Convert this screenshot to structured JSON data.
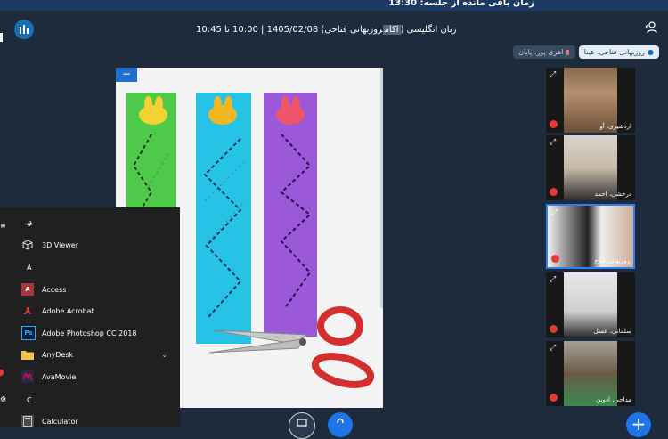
{
  "topbar": {
    "timer_text": "زمان باقی مانده از جلسه: 13:30"
  },
  "header": {
    "title_before": "زبان انگلیسی (",
    "title_highlight": "اکام",
    "title_after": "روزبهانی فتاحی) 1405/02/08 | 10:00 تا 10:45"
  },
  "chips": [
    {
      "label": "روزبهانی فتاحی، هینا",
      "icon": "pin-icon"
    },
    {
      "label": "اهری پور، پایان",
      "icon": "pin-icon"
    }
  ],
  "content": {
    "minimize_label": "−"
  },
  "participants": [
    {
      "name": "اردشیری، آوا"
    },
    {
      "name": "درخشی، احمد"
    },
    {
      "name": "روزبهانی فتاح"
    },
    {
      "name": "سلمانی، عسل"
    },
    {
      "name": "مداحی، ادوین"
    }
  ],
  "start_menu": {
    "sections": [
      {
        "letter": "#",
        "items": [
          {
            "label": "3D Viewer",
            "icon": "cube-icon"
          }
        ]
      },
      {
        "letter": "A",
        "items": [
          {
            "label": "Access",
            "icon": "access-icon"
          },
          {
            "label": "Adobe Acrobat",
            "icon": "acrobat-icon"
          },
          {
            "label": "Adobe Photoshop CC 2018",
            "icon": "photoshop-icon"
          },
          {
            "label": "AnyDesk",
            "icon": "folder-icon",
            "expandable": true
          },
          {
            "label": "AvaMovie",
            "icon": "avamovie-icon"
          }
        ]
      },
      {
        "letter": "C",
        "items": [
          {
            "label": "Calculator",
            "icon": "calculator-icon"
          }
        ]
      }
    ]
  },
  "fab": {
    "label": "+"
  },
  "colors": {
    "accent": "#1e74e8",
    "background": "#1e2b3c",
    "menu_bg": "#202020"
  }
}
